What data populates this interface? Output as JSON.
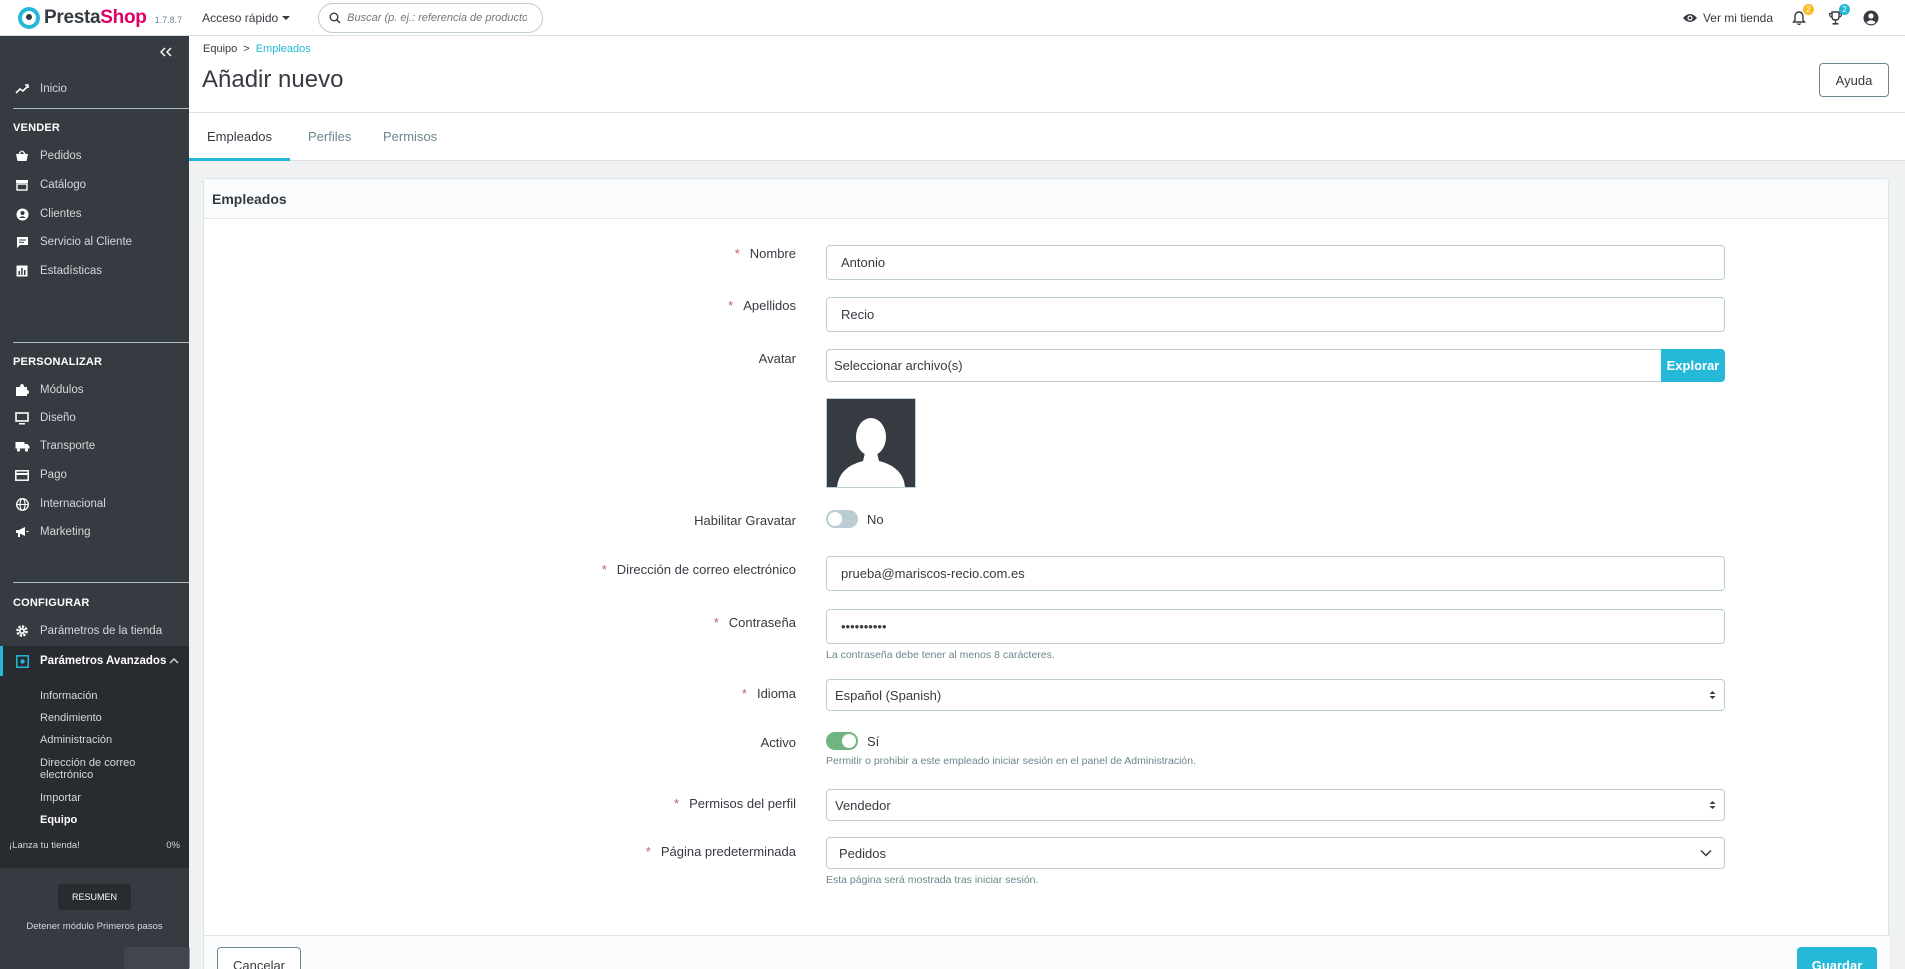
{
  "header": {
    "logo_prefix": "Presta",
    "logo_suffix": "Shop",
    "version": "1.7.8.7",
    "quick_access": "Acceso rápido",
    "search_placeholder": "Buscar (p. ej.: referencia de producto,",
    "view_store": "Ver mi tienda",
    "notifications_count": "2",
    "trophy_count": "2"
  },
  "sidebar": {
    "home": "Inicio",
    "sections": {
      "sell": "VENDER",
      "customize": "PERSONALIZAR",
      "configure": "CONFIGURAR"
    },
    "sell_items": [
      "Pedidos",
      "Catálogo",
      "Clientes",
      "Servicio al Cliente",
      "Estadísticas"
    ],
    "customize_items": [
      "Módulos",
      "Diseño",
      "Transporte",
      "Pago",
      "Internacional",
      "Marketing"
    ],
    "configure_items": [
      "Parámetros de la tienda",
      "Parámetros Avanzados"
    ],
    "advanced_subitems": [
      "Información",
      "Rendimiento",
      "Administración",
      "Dirección de correo",
      "electrónico",
      "Importar",
      "Equipo"
    ],
    "onboarding": {
      "label": "¡Lanza tu tienda!",
      "percent_text": "0%",
      "progress": 0,
      "resume": "RESUMEN",
      "stop": "Detener módulo Primeros pasos"
    }
  },
  "pagehead": {
    "breadcrumb_parent": "Equipo",
    "breadcrumb_sep": ">",
    "breadcrumb_current": "Empleados",
    "title": "Añadir nuevo",
    "help": "Ayuda"
  },
  "tabs": [
    "Empleados",
    "Perfiles",
    "Permisos"
  ],
  "form": {
    "card_title": "Empleados",
    "required_mark": "*",
    "firstname_label": "Nombre",
    "firstname_value": "Antonio",
    "lastname_label": "Apellidos",
    "lastname_value": "Recio",
    "avatar_label": "Avatar",
    "avatar_file_text": "Seleccionar archivo(s)",
    "avatar_browse": "Explorar",
    "gravatar_label": "Habilitar Gravatar",
    "gravatar_state": "No",
    "email_label": "Dirección de correo electrónico",
    "email_value": "prueba@mariscos-recio.com.es",
    "password_label": "Contraseña",
    "password_value": "••••••••••",
    "password_hint": "La contraseña debe tener al menos 8 carácteres.",
    "language_label": "Idioma",
    "language_value": "Español (Spanish)",
    "active_label": "Activo",
    "active_state": "Sí",
    "active_hint": "Permitir o prohibir a este empleado iniciar sesión en el panel de Administración.",
    "profile_label": "Permisos del perfil",
    "profile_value": "Vendedor",
    "default_page_label": "Página predeterminada",
    "default_page_value": "Pedidos",
    "default_page_hint": "Esta página será mostrada tras iniciar sesión.",
    "cancel": "Cancelar",
    "save": "Guardar"
  },
  "colors": {
    "brand": "#25b9d7",
    "sidebar_bg": "#363a41",
    "toggle_on": "#70b580",
    "required": "#c05c67"
  }
}
